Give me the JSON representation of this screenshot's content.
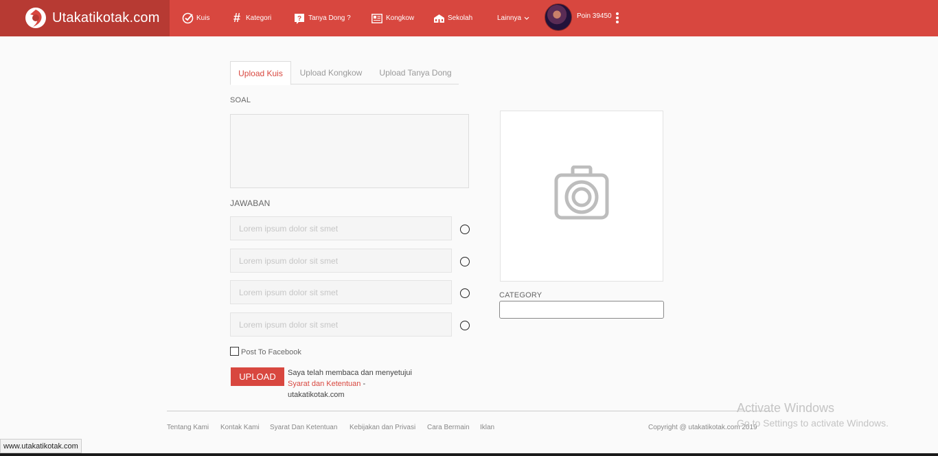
{
  "header": {
    "brand": "Utakatikotak.com",
    "nav": [
      {
        "label": "Kuis",
        "icon": "check-circle-icon"
      },
      {
        "label": "Kategori",
        "icon": "hash-icon"
      },
      {
        "label": "Tanya Dong ?",
        "icon": "question-icon"
      },
      {
        "label": "Kongkow",
        "icon": "news-icon"
      },
      {
        "label": "Sekolah",
        "icon": "school-icon"
      },
      {
        "label": "Lainnya",
        "icon": "chevron-down-icon"
      }
    ],
    "poin": "Poin 39450"
  },
  "tabs": [
    "Upload Kuis",
    "Upload Kongkow",
    "Upload Tanya Dong"
  ],
  "active_tab": "Upload Kuis",
  "form": {
    "soal_label": "SOAL",
    "jawaban_label": "JAWABAN",
    "answer_placeholders": [
      "Lorem ipsum dolor sit smet",
      "Lorem ipsum dolor sit smet",
      "Lorem ipsum dolor sit smet",
      "Lorem ipsum dolor sit smet"
    ],
    "facebook_label": "Post To Facebook",
    "upload_button": "UPLOAD",
    "agree_text": "Saya telah membaca dan menyetujui",
    "terms_link": "Syarat dan Ketentuan",
    "agree_suffix": " -",
    "agree_site": "utakatikotak.com",
    "category_label": "CATEGORY"
  },
  "footer": {
    "links": [
      "Tentang Kami",
      "Kontak Kami",
      "Syarat Dan Ketentuan",
      "Kebijakan dan Privasi",
      "Cara Bermain",
      "Iklan"
    ],
    "copyright": "Copyright @ utakatikotak.com 2019"
  },
  "overlay": {
    "activate_title": "Activate Windows",
    "activate_sub": "Go to Settings to activate Windows.",
    "status_url": "www.utakatikotak.com"
  },
  "colors": {
    "brand_red": "#d8473f",
    "brand_dark": "#b73a33"
  }
}
